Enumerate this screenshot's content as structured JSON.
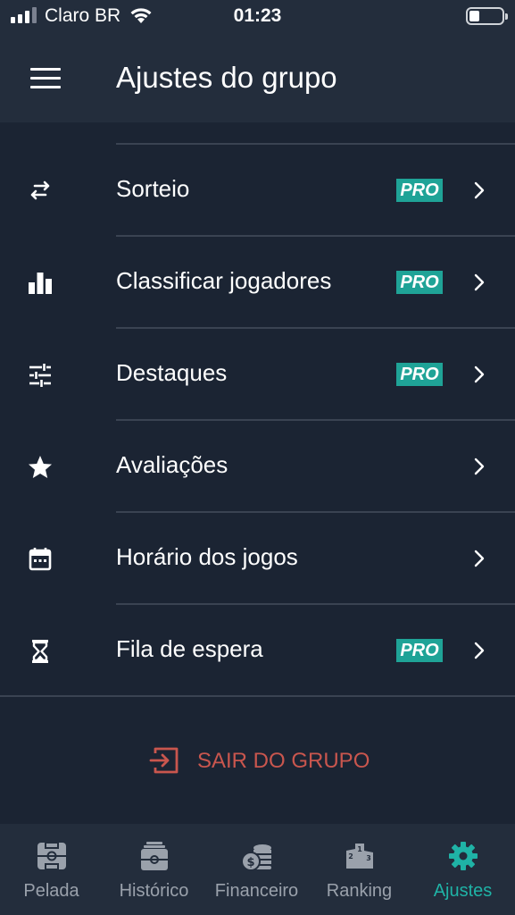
{
  "status": {
    "carrier": "Claro BR",
    "time": "01:23"
  },
  "appbar": {
    "title": "Ajustes do grupo"
  },
  "settings": {
    "items": [
      {
        "label": "Sorteio",
        "pro": "PRO",
        "icon": "swap-arrows-icon"
      },
      {
        "label": "Classificar jogadores",
        "pro": "PRO",
        "icon": "bar-chart-icon"
      },
      {
        "label": "Destaques",
        "pro": "PRO",
        "icon": "tune-sliders-icon"
      },
      {
        "label": "Avaliações",
        "pro": "",
        "icon": "star-icon"
      },
      {
        "label": "Horário dos jogos",
        "pro": "",
        "icon": "calendar-icon"
      },
      {
        "label": "Fila de espera",
        "pro": "PRO",
        "icon": "hourglass-icon"
      }
    ]
  },
  "leave": {
    "label": "SAIR DO GRUPO",
    "icon": "exit-icon"
  },
  "tabbar": {
    "tabs": [
      {
        "label": "Pelada",
        "icon": "field-icon"
      },
      {
        "label": "Histórico",
        "icon": "history-icon"
      },
      {
        "label": "Financeiro",
        "icon": "coins-icon"
      },
      {
        "label": "Ranking",
        "icon": "podium-icon"
      },
      {
        "label": "Ajustes",
        "icon": "gear-icon",
        "active": true
      }
    ]
  },
  "colors": {
    "background": "#1b2433",
    "header": "#232d3c",
    "accent": "#1fa397",
    "danger": "#c9564e",
    "divider": "#3a4352",
    "inactive_tab": "#9aa1ab"
  }
}
